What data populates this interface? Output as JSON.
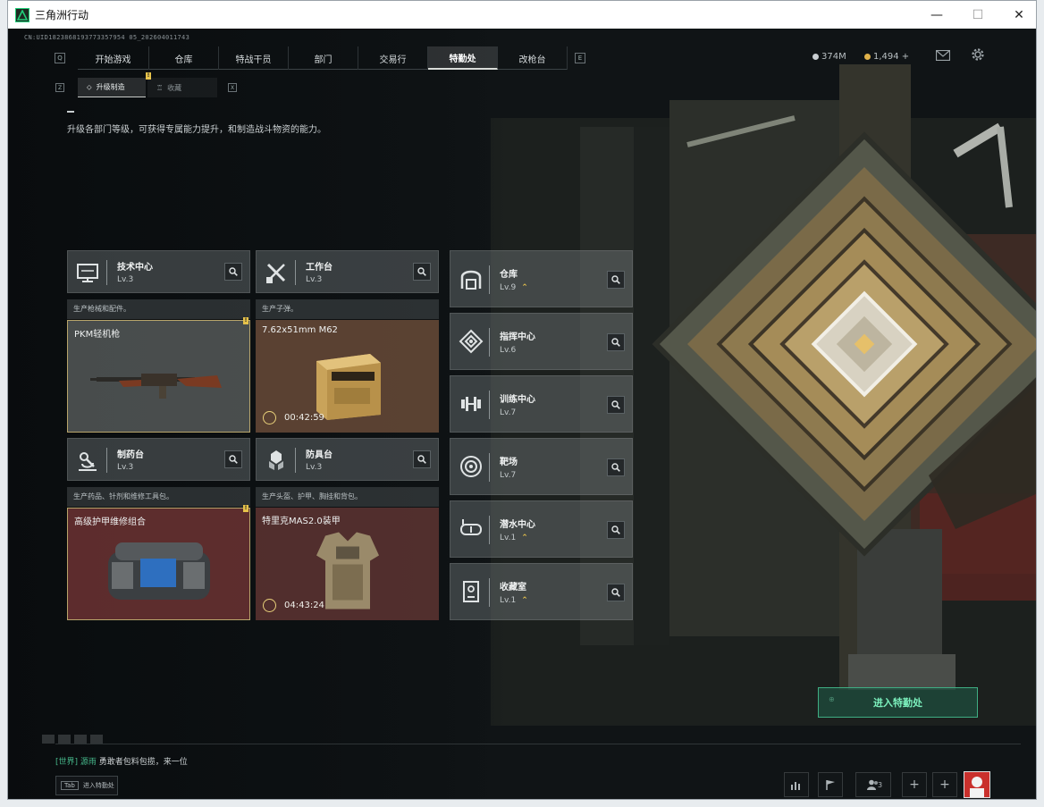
{
  "window": {
    "title": "三角洲行动",
    "min_glyph": "—",
    "max_glyph": "☐",
    "close_glyph": "✕"
  },
  "uid": "CN:UID1823868193773357954 05_202604011743",
  "nav": {
    "left_key": "Q",
    "right_key": "E",
    "tabs": [
      "开始游戏",
      "仓库",
      "特战干员",
      "部门",
      "交易行",
      "特勤处",
      "改枪台"
    ],
    "active": "特勤处",
    "badge": "!"
  },
  "currency": [
    {
      "value": "374M",
      "color": "#c9ced2"
    },
    {
      "value": "1,494 +",
      "color": "#e0b24a"
    }
  ],
  "subnav": {
    "left_key": "Z",
    "right_key": "X",
    "tabs": [
      "升级制造",
      "收藏"
    ],
    "active": "升级制造"
  },
  "description": "升级各部门等级，可获得专属能力提升，和制造战斗物资的能力。",
  "production_facilities": [
    {
      "name": "技术中心",
      "level": "Lv.3",
      "desc": "生产枪械和配件。",
      "item": "PKM轻机枪",
      "timer": "",
      "style": "grey",
      "alert": true,
      "icon": "monitor-icon"
    },
    {
      "name": "工作台",
      "level": "Lv.3",
      "desc": "生产子弹。",
      "item": "7.62x51mm M62",
      "timer": "00:42:59",
      "style": "brown",
      "alert": false,
      "icon": "tools-icon"
    },
    {
      "name": "制药台",
      "level": "Lv.3",
      "desc": "生产药品、针剂和维修工具包。",
      "item": "高级护甲维修组合",
      "timer": "",
      "style": "red",
      "alert": true,
      "icon": "microscope-icon"
    },
    {
      "name": "防具台",
      "level": "Lv.3",
      "desc": "生产头盔、护甲、胸挂和背包。",
      "item": "特里克MAS2.0装甲",
      "timer": "04:43:24",
      "style": "wine",
      "alert": false,
      "icon": "armor-icon"
    }
  ],
  "facilities": [
    {
      "name": "仓库",
      "level": "Lv.9",
      "upgradable": true,
      "icon": "warehouse-icon"
    },
    {
      "name": "指挥中心",
      "level": "Lv.6",
      "upgradable": false,
      "icon": "command-icon"
    },
    {
      "name": "训练中心",
      "level": "Lv.7",
      "upgradable": false,
      "icon": "dumbbell-icon"
    },
    {
      "name": "靶场",
      "level": "Lv.7",
      "upgradable": false,
      "icon": "target-icon"
    },
    {
      "name": "潜水中心",
      "level": "Lv.1",
      "upgradable": true,
      "icon": "diving-icon"
    },
    {
      "name": "收藏室",
      "level": "Lv.1",
      "upgradable": true,
      "icon": "trophy-icon"
    }
  ],
  "upgrade_glyph": "⌃",
  "enter_button": {
    "label": "进入特勤处",
    "tag": "⊕"
  },
  "chat": {
    "channel": "[世界]",
    "sender": "源雨",
    "message": "勇敢者包料包揽，来一位"
  },
  "tab_hint": {
    "key": "Tab",
    "label": "进入特勤处"
  },
  "squad_count": "3",
  "colors": {
    "accent_green": "#3fae83",
    "alert_yellow": "#e6c24a"
  }
}
